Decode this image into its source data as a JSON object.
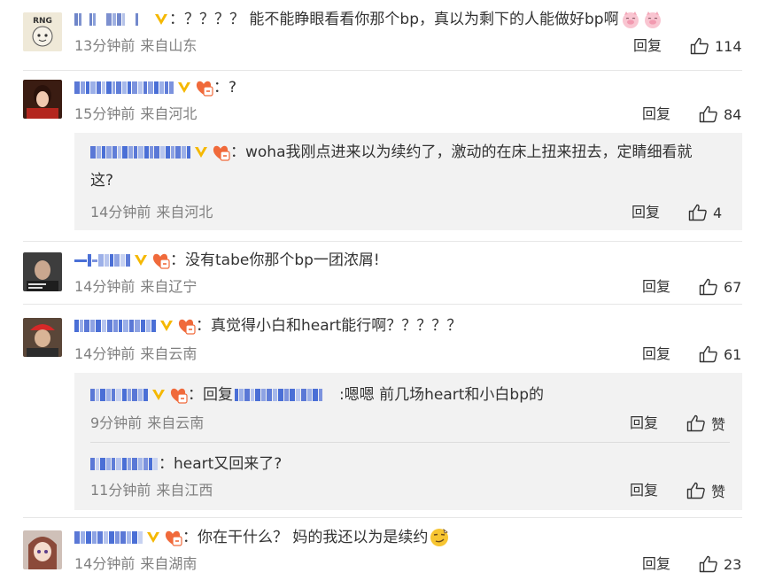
{
  "comments": [
    {
      "text": "：？？？？ 能不能睁眼看看你那个bp，真以为剩下的人能做好bp啊",
      "time": "13分钟前",
      "location": "来自山东",
      "reply_label": "回复",
      "likes": "114",
      "avatar_text": "RNG",
      "emojis": [
        "pig-emoji",
        "pig-emoji"
      ]
    },
    {
      "text": "：?",
      "time": "15分钟前",
      "location": "来自河北",
      "reply_label": "回复",
      "likes": "84"
    },
    {
      "text": "：没有tabe你那个bp一团浓屑!",
      "time": "14分钟前",
      "location": "来自辽宁",
      "reply_label": "回复",
      "likes": "67"
    },
    {
      "text": "：真觉得小白和heart能行啊？？？？？",
      "time": "14分钟前",
      "location": "来自云南",
      "reply_label": "回复",
      "likes": "61"
    },
    {
      "text": "：你在干什么？ 妈的我还以为是续约",
      "time": "14分钟前",
      "location": "来自湖南",
      "reply_label": "回复",
      "likes": "23"
    }
  ],
  "subreplies": [
    {
      "text_line1": "：woha我刚点进来以为续约了，激动的在床上扭来扭去，定睛细看就",
      "text_line2": "这?",
      "time": "14分钟前",
      "location": "来自河北",
      "reply_label": "回复",
      "likes": "4"
    },
    {
      "prefix": "：回复",
      "text": ":嗯嗯 前几场heart和小白bp的",
      "time": "9分钟前",
      "location": "来自云南",
      "reply_label": "回复",
      "likes": "赞"
    },
    {
      "text": "：heart又回来了?",
      "time": "11分钟前",
      "location": "来自江西",
      "reply_label": "回复",
      "likes": "赞"
    }
  ],
  "colors": {
    "text": "#333333",
    "meta": "#808080",
    "verified": "#f5b800",
    "medal": "#f06a3b",
    "name_blue": "#4a6fd6",
    "sub_bg": "#f2f2f2"
  }
}
